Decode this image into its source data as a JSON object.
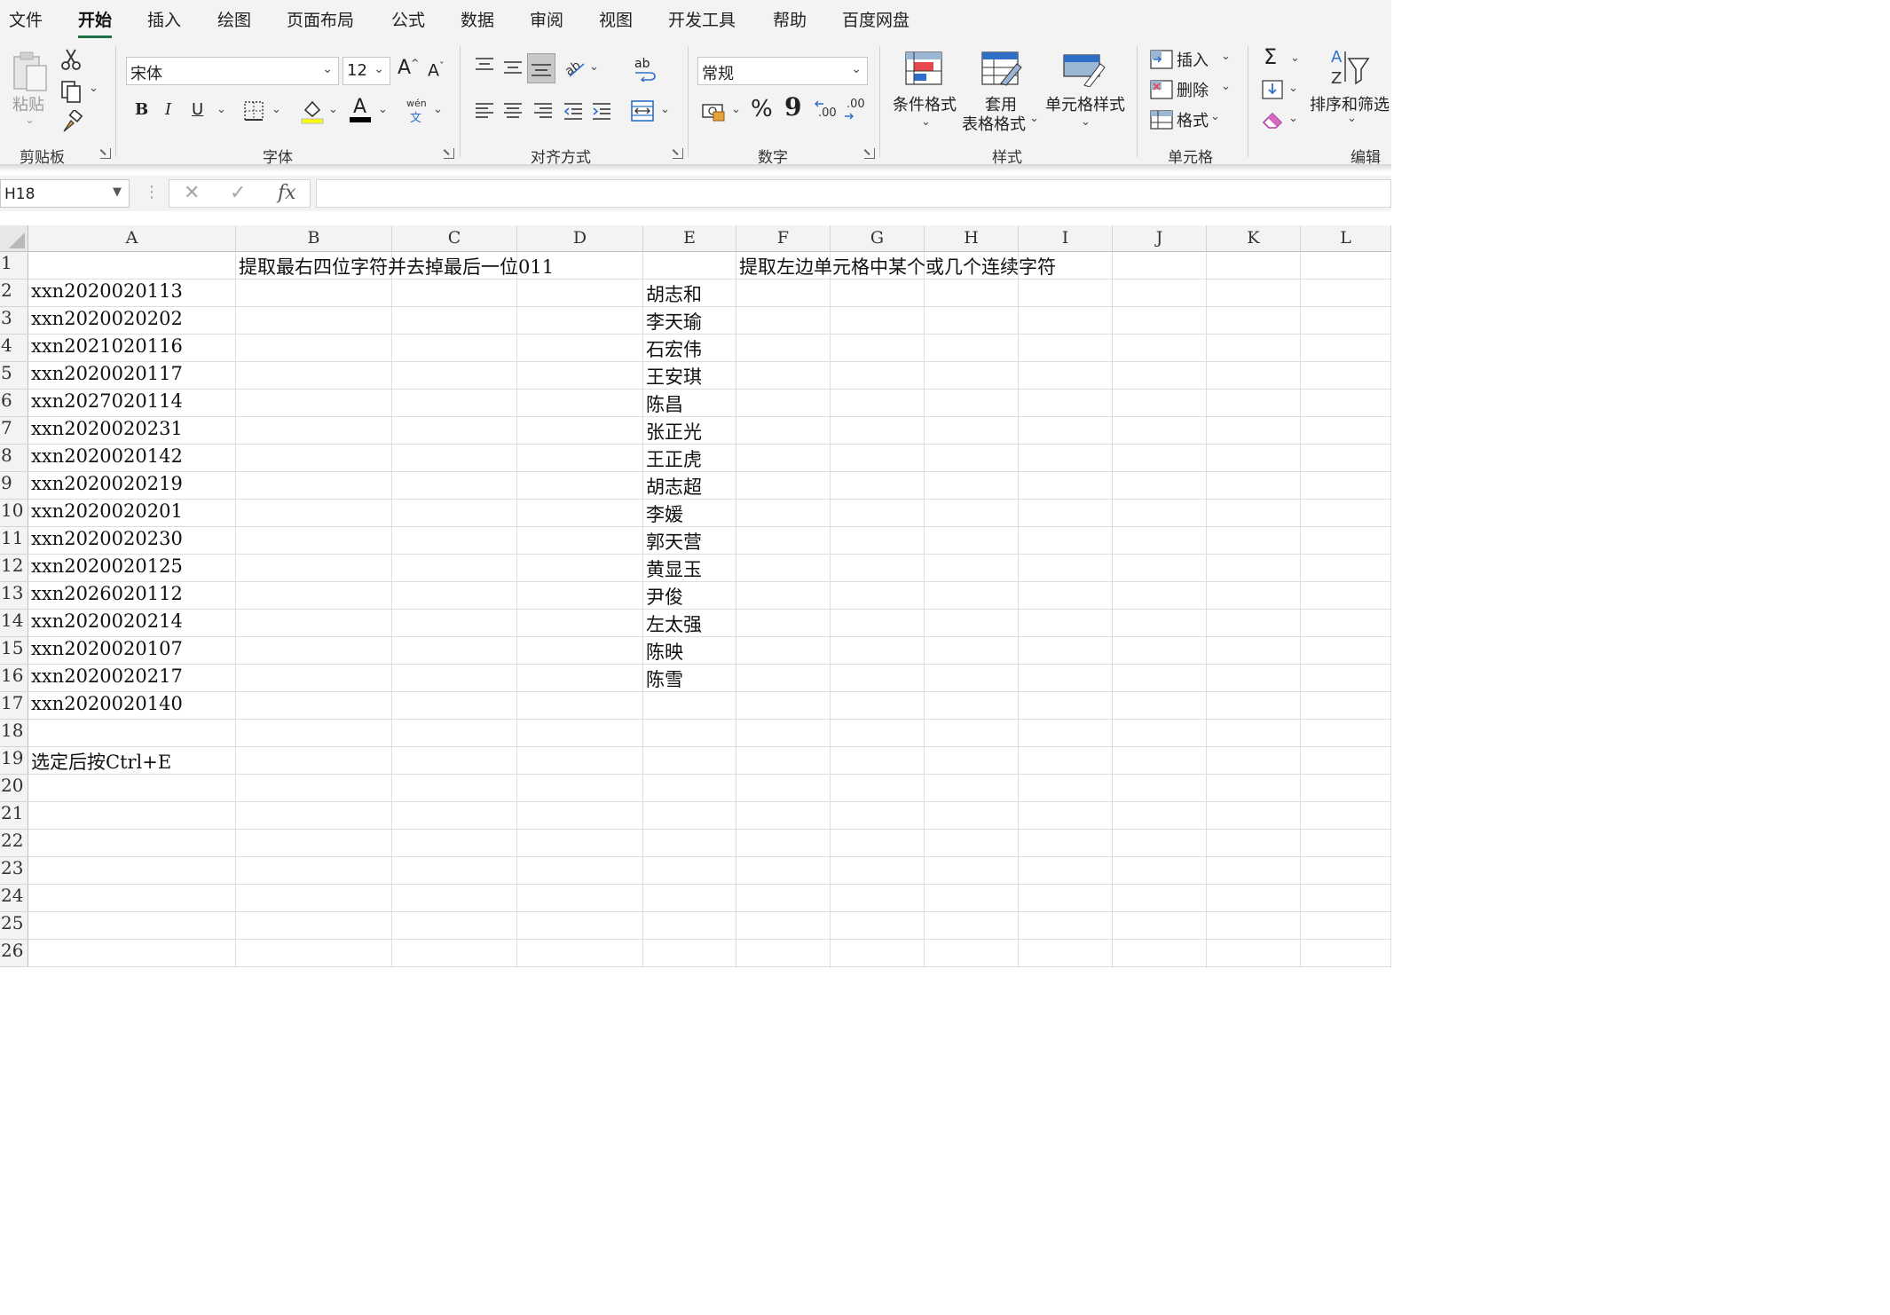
{
  "tabs": [
    "文件",
    "开始",
    "插入",
    "绘图",
    "页面布局",
    "公式",
    "数据",
    "审阅",
    "视图",
    "开发工具",
    "帮助",
    "百度网盘"
  ],
  "active_tab": "开始",
  "ribbon": {
    "clipboard": {
      "paste": "粘贴",
      "group": "剪贴板"
    },
    "font": {
      "name": "宋体",
      "size": "12",
      "grow": "A",
      "shrink": "A",
      "bold": "B",
      "italic": "I",
      "underline": "U",
      "color_letter": "A",
      "phonetic_top": "wén",
      "phonetic_bottom": "文",
      "group": "字体"
    },
    "alignment": {
      "group": "对齐方式",
      "wrap_label": "ab"
    },
    "number": {
      "format": "常规",
      "percent": "%",
      "comma": "9",
      "inc_dec": ".00",
      "group": "数字"
    },
    "styles": {
      "conditional": "条件格式",
      "table_line1": "套用",
      "table_line2": "表格格式",
      "cell_styles": "单元格样式",
      "group": "样式"
    },
    "cells": {
      "insert": "插入",
      "delete": "删除",
      "format": "格式",
      "group": "单元格"
    },
    "editing": {
      "sum": "Σ",
      "sort_filter": "排序和筛选",
      "group": "编辑"
    }
  },
  "formula_bar": {
    "name_box": "H18",
    "cancel": "✕",
    "enter": "✓",
    "fx": "fx",
    "value": ""
  },
  "sheet": {
    "columns": [
      "A",
      "B",
      "C",
      "D",
      "E",
      "F",
      "G",
      "H",
      "I",
      "J",
      "K",
      "L"
    ],
    "rows": [
      "1",
      "2",
      "3",
      "4",
      "5",
      "6",
      "7",
      "8",
      "9",
      "10",
      "11",
      "12",
      "13",
      "14",
      "15",
      "16",
      "17",
      "18",
      "19",
      "20",
      "21",
      "22",
      "23",
      "24",
      "25",
      "26"
    ],
    "cells": {
      "B1": "提取最右四位字符并去掉最后一位011",
      "F1": "提取左边单元格中某个或几个连续字符",
      "A2": "xxn2020020113",
      "A3": "xxn2020020202",
      "A4": "xxn2021020116",
      "A5": "xxn2020020117",
      "A6": "xxn2027020114",
      "A7": "xxn2020020231",
      "A8": "xxn2020020142",
      "A9": "xxn2020020219",
      "A10": "xxn2020020201",
      "A11": "xxn2020020230",
      "A12": "xxn2020020125",
      "A13": "xxn2026020112",
      "A14": "xxn2020020214",
      "A15": "xxn2020020107",
      "A16": "xxn2020020217",
      "A17": "xxn2020020140",
      "A19": "选定后按Ctrl+E",
      "E2": "胡志和",
      "E3": "李天瑜",
      "E4": "石宏伟",
      "E5": "王安琪",
      "E6": "陈昌",
      "E7": "张正光",
      "E8": "王正虎",
      "E9": "胡志超",
      "E10": "李媛",
      "E11": "郭天营",
      "E12": "黄显玉",
      "E13": "尹俊",
      "E14": "左太强",
      "E15": "陈映",
      "E16": "陈雪"
    }
  }
}
